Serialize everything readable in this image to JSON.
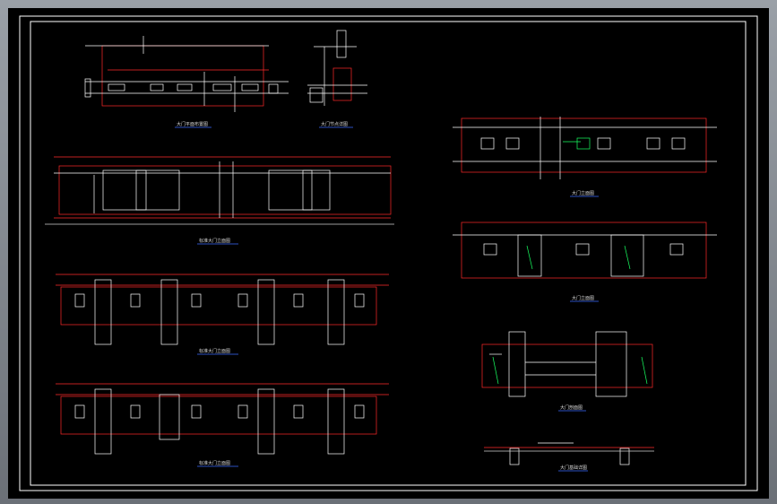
{
  "colors": {
    "background": "#000000",
    "border": "#ffffff",
    "outline": "#ff2a2a",
    "linework": "#ffffff",
    "dimension": "#d0d0d0",
    "accent": "#18ff60",
    "caption_underline": "#3a6dff"
  },
  "captions": {
    "plan_top": "大门平面布置图",
    "detail_top": "大门节点详图",
    "elev_a": "标准大门立面图",
    "elev_b": "标准大门立面图",
    "elev_c": "标准大门立面图",
    "right_elev1": "大门立面图",
    "right_elev2": "大门立面图",
    "right_section": "大门剖面图",
    "right_detail": "大门基础详图"
  }
}
